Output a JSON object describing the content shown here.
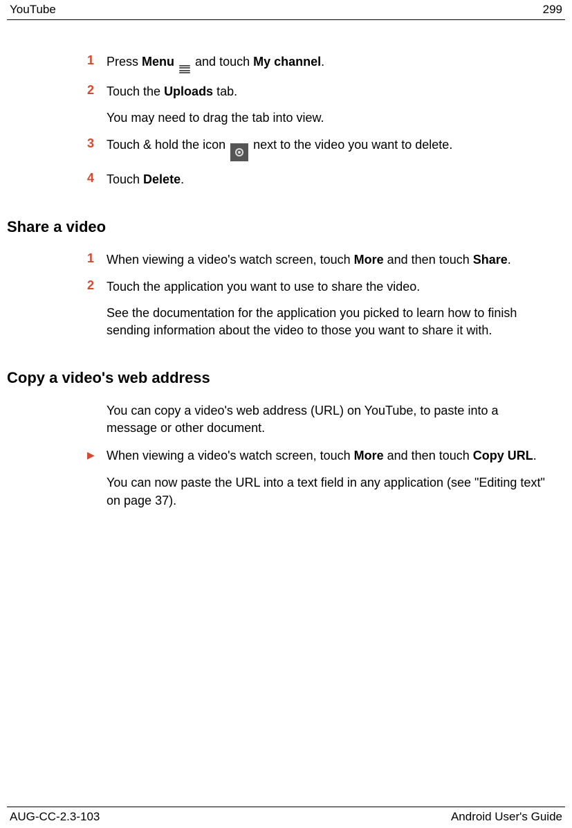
{
  "header": {
    "left": "YouTube",
    "right": "299"
  },
  "section1": {
    "steps": [
      {
        "num": "1",
        "pre": "Press ",
        "b1": "Menu",
        "mid": " ",
        "icon": "menu",
        "post1": " and touch ",
        "b2": "My channel",
        "post2": "."
      },
      {
        "num": "2",
        "pre": "Touch the ",
        "b1": "Uploads",
        "post1": " tab.",
        "sub": "You may need to drag the tab into view."
      },
      {
        "num": "3",
        "pre": "Touch & hold the icon ",
        "icon": "video",
        "post1": " next to the video you want to delete."
      },
      {
        "num": "4",
        "pre": "Touch ",
        "b1": "Delete",
        "post1": "."
      }
    ]
  },
  "section2": {
    "heading": "Share a video",
    "steps": [
      {
        "num": "1",
        "pre": "When viewing a video's watch screen, touch ",
        "b1": "More",
        "mid": " and then touch ",
        "b2": "Share",
        "post2": "."
      },
      {
        "num": "2",
        "pre": "Touch the application you want to use to share the video.",
        "sub": "See the documentation for the application you picked to learn how to finish sending information about the video to those you want to share it with."
      }
    ]
  },
  "section3": {
    "heading": "Copy a video's web address",
    "intro": "You can copy a video's web address (URL) on YouTube, to paste into a message or other document.",
    "bullet": {
      "mark": "▶",
      "pre": "When viewing a video's watch screen, touch ",
      "b1": "More",
      "mid": " and then touch ",
      "b2": "Copy URL",
      "post2": "."
    },
    "bulletSub": "You can now paste the URL into a text field in any application (see \"Editing text\" on page 37)."
  },
  "footer": {
    "left": "AUG-CC-2.3-103",
    "right": "Android User's Guide"
  }
}
